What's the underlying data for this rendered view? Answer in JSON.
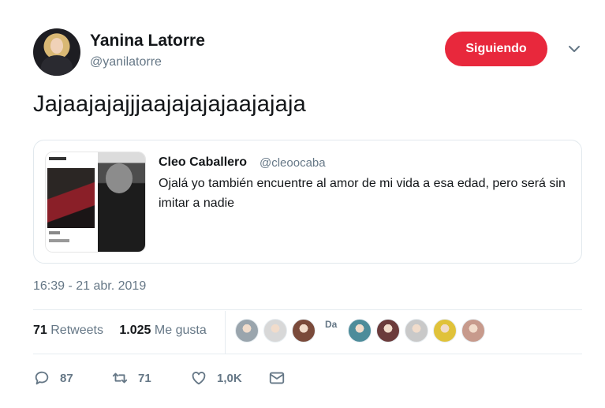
{
  "author": {
    "name": "Yanina Latorre",
    "handle": "@yanilatorre",
    "follow_label": "Siguiendo"
  },
  "tweet": {
    "text": "Jajaajajajjjaajajajajaajajaja"
  },
  "quoted": {
    "name": "Cleo Caballero",
    "handle": "@cleoocaba",
    "text": "Ojalá yo también encuentre al amor de mi vida a esa edad, pero será sin imitar a nadie"
  },
  "timestamp": "16:39 - 21 abr. 2019",
  "stats": {
    "retweets_count": "71",
    "retweets_label": "Retweets",
    "likes_count": "1.025",
    "likes_label": "Me gusta"
  },
  "likers": {
    "badge_text": "Da",
    "colors": [
      "#9aa5ad",
      "#d8d8d8",
      "#7a4a3a",
      "#4d8c9a",
      "#6b3b3b",
      "#c9c9c9",
      "#e0c23a",
      "#c79a8c"
    ]
  },
  "actions": {
    "replies": "87",
    "retweets": "71",
    "likes": "1,0K"
  },
  "colors": {
    "follow_button": "#e8283c",
    "secondary_text": "#657786",
    "border": "#e1e8ed"
  },
  "icons": [
    "chevron-down-icon",
    "reply-icon",
    "retweet-icon",
    "heart-icon",
    "message-icon"
  ]
}
